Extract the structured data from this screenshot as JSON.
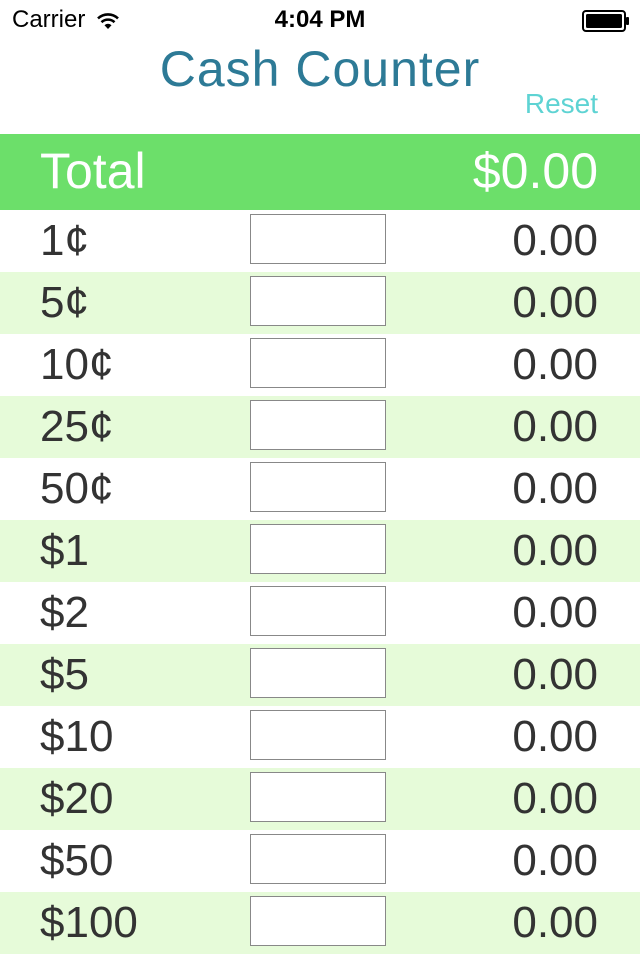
{
  "status_bar": {
    "carrier": "Carrier",
    "time": "4:04 PM",
    "icons": [
      "wifi-icon",
      "battery-icon"
    ]
  },
  "header": {
    "title": "Cash Counter",
    "reset_label": "Reset"
  },
  "total": {
    "label": "Total",
    "value": "$0.00"
  },
  "colors": {
    "title": "#2d7a96",
    "reset": "#5ed3d3",
    "total_bar": "#6cdf6a",
    "alt_row": "#e6fbd9"
  },
  "rows": [
    {
      "denomination": "1¢",
      "count": "",
      "amount": "0.00"
    },
    {
      "denomination": "5¢",
      "count": "",
      "amount": "0.00"
    },
    {
      "denomination": "10¢",
      "count": "",
      "amount": "0.00"
    },
    {
      "denomination": "25¢",
      "count": "",
      "amount": "0.00"
    },
    {
      "denomination": "50¢",
      "count": "",
      "amount": "0.00"
    },
    {
      "denomination": "$1",
      "count": "",
      "amount": "0.00"
    },
    {
      "denomination": "$2",
      "count": "",
      "amount": "0.00"
    },
    {
      "denomination": "$5",
      "count": "",
      "amount": "0.00"
    },
    {
      "denomination": "$10",
      "count": "",
      "amount": "0.00"
    },
    {
      "denomination": "$20",
      "count": "",
      "amount": "0.00"
    },
    {
      "denomination": "$50",
      "count": "",
      "amount": "0.00"
    },
    {
      "denomination": "$100",
      "count": "",
      "amount": "0.00"
    }
  ]
}
